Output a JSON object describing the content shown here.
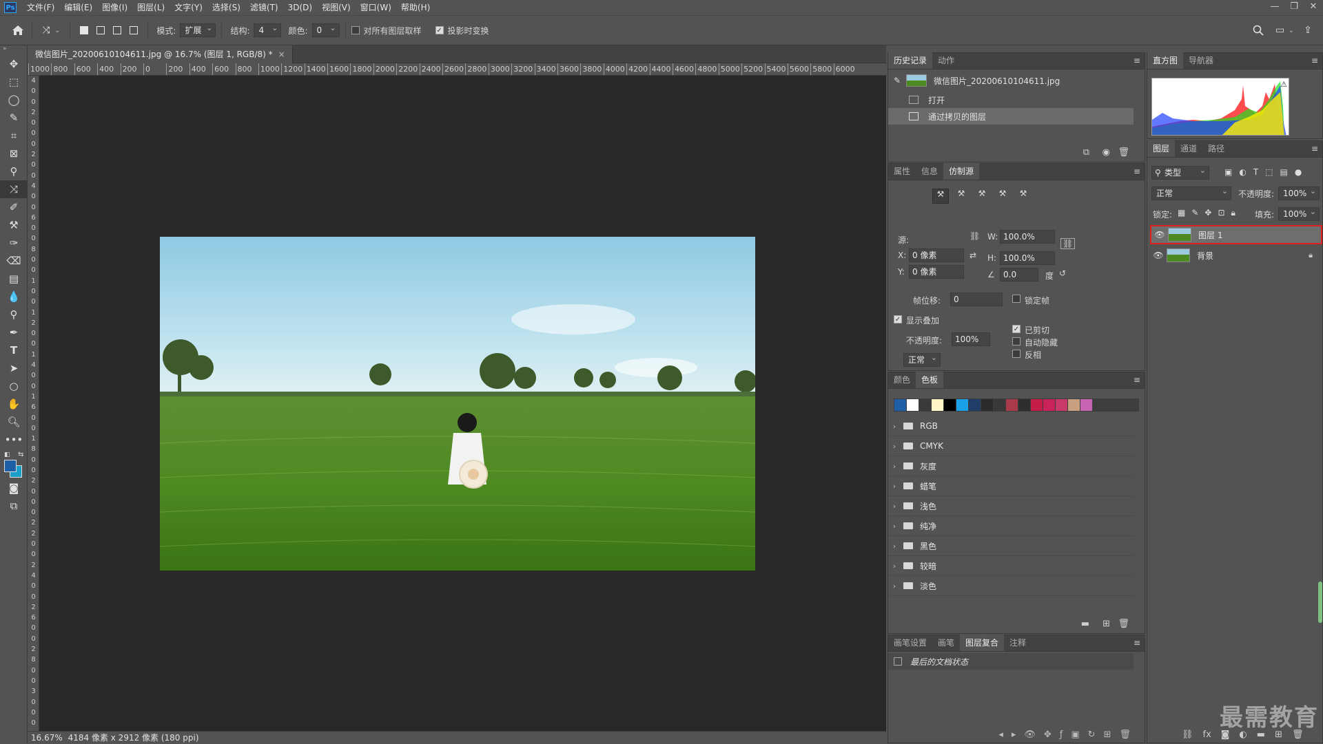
{
  "app": {
    "logo_text": "Ps"
  },
  "menu": [
    "文件(F)",
    "编辑(E)",
    "图像(I)",
    "图层(L)",
    "文字(Y)",
    "选择(S)",
    "滤镜(T)",
    "3D(D)",
    "视图(V)",
    "窗口(W)",
    "帮助(H)"
  ],
  "options": {
    "mode_label": "模式:",
    "mode_value": "扩展",
    "structure_label": "结构:",
    "structure_value": "4",
    "color_label": "颜色:",
    "color_value": "0",
    "sample_all_label": "对所有图层取样",
    "transform_label": "投影时变换"
  },
  "document": {
    "tab_title": "微信图片_20200610104611.jpg @ 16.7% (图层 1, RGB/8) *",
    "ruler_ticks": [
      "1000",
      "800",
      "600",
      "400",
      "200",
      "0",
      "200",
      "400",
      "600",
      "800",
      "1000",
      "1200",
      "1400",
      "1600",
      "1800",
      "2000",
      "2200",
      "2400",
      "2600",
      "2800",
      "3000",
      "3200",
      "3400",
      "3600",
      "3800",
      "4000",
      "4200",
      "4400",
      "4600",
      "4800",
      "5000",
      "5200",
      "5400",
      "5600",
      "5800",
      "6000"
    ],
    "ruler_v": [
      "4",
      "0",
      "0",
      "2",
      "0",
      "0",
      "0",
      "2",
      "0",
      "0",
      "4",
      "0",
      "0",
      "6",
      "0",
      "0",
      "8",
      "0",
      "0",
      "1",
      "0",
      "0",
      "1",
      "2",
      "0",
      "0",
      "1",
      "4",
      "0",
      "0",
      "1",
      "6",
      "0",
      "0",
      "1",
      "8",
      "0",
      "0",
      "2",
      "0",
      "0",
      "0",
      "2",
      "2",
      "0",
      "0",
      "2",
      "4",
      "0",
      "0",
      "2",
      "6",
      "0",
      "0",
      "2",
      "8",
      "0",
      "0",
      "3",
      "0",
      "0",
      "0"
    ],
    "zoom": "16.67%",
    "size_info": "4184 像素 x 2912 像素 (180 ppi)"
  },
  "history_panel": {
    "tabs": [
      "历史记录",
      "动作"
    ],
    "snapshot": "微信图片_20200610104611.jpg",
    "steps": [
      "打开",
      "通过拷贝的图层"
    ]
  },
  "clone_panel": {
    "tabs": [
      "属性",
      "信息",
      "仿制源"
    ],
    "source_label": "源:",
    "x_label": "X:",
    "x_value": "0 像素",
    "y_label": "Y:",
    "y_value": "0 像素",
    "w_label": "W:",
    "w_value": "100.0%",
    "h_label": "H:",
    "h_value": "100.0%",
    "angle_value": "0.0",
    "angle_unit": "度",
    "frame_offset_label": "帧位移:",
    "frame_offset_value": "0",
    "lock_frame_label": "锁定帧",
    "show_overlay_label": "显示叠加",
    "opacity_label": "不透明度:",
    "opacity_value": "100%",
    "blend_value": "正常",
    "clipped_label": "已剪切",
    "auto_hide_label": "自动隐藏",
    "invert_label": "反相"
  },
  "swatches_panel": {
    "tabs": [
      "颜色",
      "色板"
    ],
    "colors": [
      "#1f5fa8",
      "#ffffff",
      "#3a3a3a",
      "#fff6c8",
      "#000000",
      "#1aa0e6",
      "#1f3d66",
      "#2a2a2a",
      "#383838",
      "#a83a4a",
      "#2e2e2e",
      "#c41e48",
      "#c8245a",
      "#c83a6a",
      "#c8a080",
      "#c864b4"
    ],
    "groups": [
      "RGB",
      "CMYK",
      "灰度",
      "蜡笔",
      "浅色",
      "纯净",
      "黑色",
      "较暗",
      "淡色"
    ]
  },
  "comps_panel": {
    "tabs": [
      "画笔设置",
      "画笔",
      "图层复合",
      "注释"
    ],
    "item": "最后的文档状态"
  },
  "histogram_panel": {
    "tabs": [
      "直方图",
      "导航器"
    ]
  },
  "layers_panel": {
    "tabs": [
      "图层",
      "通道",
      "路径"
    ],
    "filter_value": "类型",
    "blend_value": "正常",
    "opacity_label": "不透明度:",
    "opacity_value": "100%",
    "lock_label": "锁定:",
    "fill_label": "填充:",
    "fill_value": "100%",
    "layers": [
      {
        "name": "图层 1"
      },
      {
        "name": "背景"
      }
    ]
  },
  "watermark": "最需教育",
  "colors": {
    "accent_red": "#e02020",
    "canvas": "#282828",
    "panel": "#535353"
  }
}
